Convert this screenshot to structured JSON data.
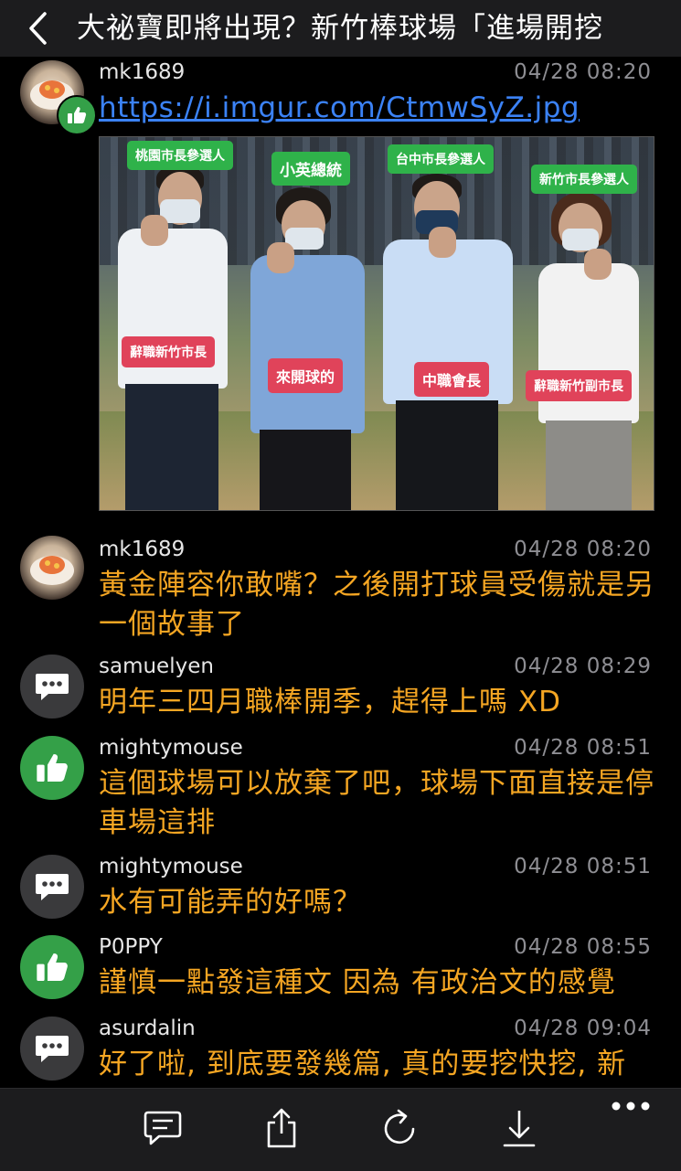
{
  "header": {
    "back_icon": "chevron-left-icon",
    "title": "大祕寶即將出現？新竹棒球場「進場開挖"
  },
  "posts": [
    {
      "user": "mk1689",
      "time": "04/28 08:20",
      "avatar": "user-photo",
      "badge": "thumbs-up-icon",
      "link": "https://i.imgur.com/CtmwSyZ.jpg",
      "image_labels": {
        "green": [
          "桃園市長參選人",
          "小英總統",
          "台中市長參選人",
          "新竹市長參選人"
        ],
        "red": [
          "辭職新竹市長",
          "來開球的",
          "中職會長",
          "辭職新竹副市長"
        ]
      }
    },
    {
      "user": "mk1689",
      "time": "04/28 08:20",
      "avatar": "user-photo",
      "text": "黃金陣容你敢嘴？之後開打球員受傷就是另一個故事了"
    },
    {
      "user": "samuelyen",
      "time": "04/28 08:29",
      "avatar": "speech-bubble-icon",
      "text": "明年三四月職棒開季，趕得上嗎 XD"
    },
    {
      "user": "mightymouse",
      "time": "04/28 08:51",
      "avatar": "thumbs-up-icon",
      "text": "這個球場可以放棄了吧，球場下面直接是停車場這排"
    },
    {
      "user": "mightymouse",
      "time": "04/28 08:51",
      "avatar": "speech-bubble-icon",
      "text": "水有可能弄的好嗎？"
    },
    {
      "user": "P0PPY",
      "time": "04/28 08:55",
      "avatar": "thumbs-up-icon",
      "text": "謹慎一點發這種文 因為 有政治文的感覺"
    },
    {
      "user": "asurdalin",
      "time": "04/28 09:04",
      "avatar": "speech-bubble-icon",
      "text": "好了啦, 到底要發幾篇, 真的要挖快挖, 新"
    }
  ],
  "toolbar": {
    "items": [
      "comment-icon",
      "share-icon",
      "refresh-icon",
      "download-icon",
      "more-icon"
    ]
  },
  "colors": {
    "background": "#000000",
    "bar": "#1c1c1e",
    "comment_text": "#f5a623",
    "link": "#3b82f6",
    "meta": "#8e8e93",
    "like_green": "#34a048"
  }
}
